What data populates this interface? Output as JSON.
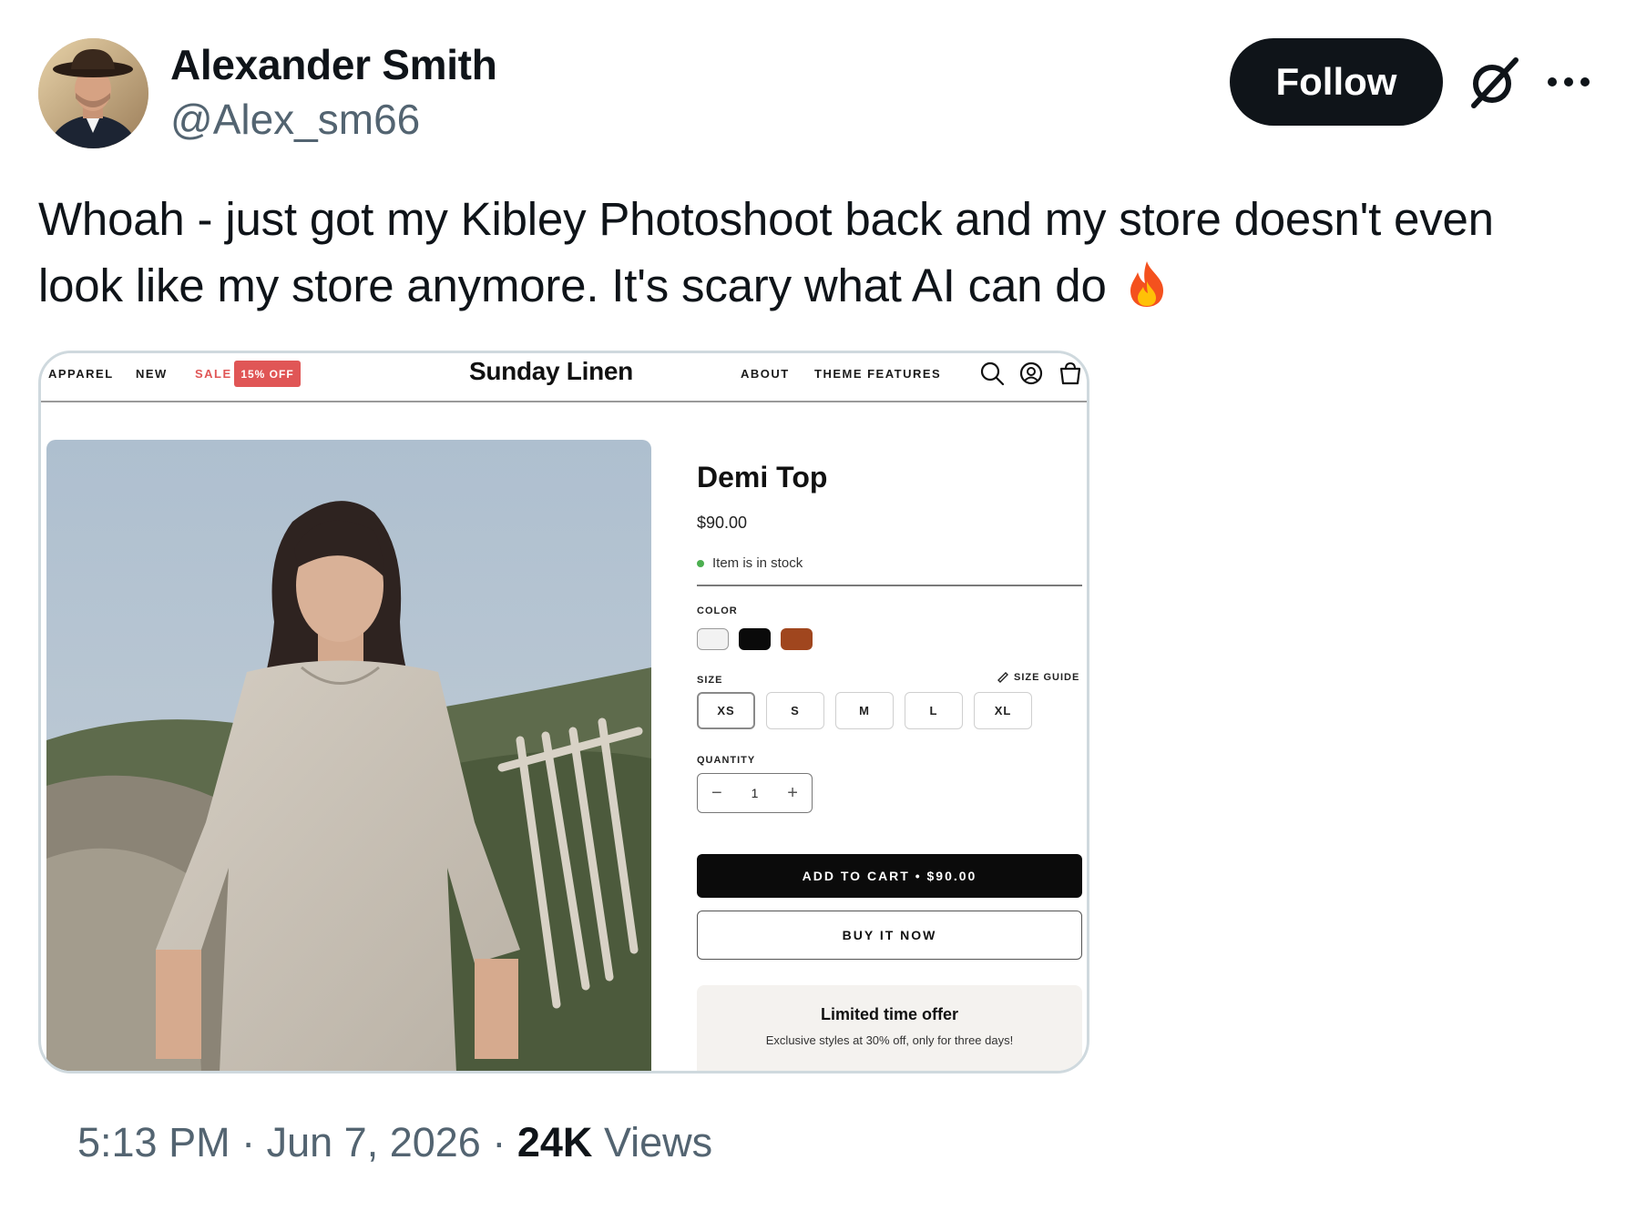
{
  "author": {
    "name": "Alexander Smith",
    "handle": "@Alex_sm66"
  },
  "actions": {
    "follow_label": "Follow",
    "grok_icon": "grok-icon",
    "more_icon": "more-icon"
  },
  "tweet": {
    "text": "Whoah - just got my Kibley Photoshoot back and my store doesn't even look like my store anymore. It's scary what AI can do",
    "emoji": "fire-icon"
  },
  "store": {
    "nav": {
      "apparel": "APPAREL",
      "new": "NEW",
      "sale": "SALE",
      "sale_badge": "15% OFF",
      "logo": "Sunday Linen",
      "about": "ABOUT",
      "theme_features": "THEME FEATURES",
      "icons": [
        "search-icon",
        "account-icon",
        "cart-icon"
      ]
    },
    "product": {
      "title": "Demi Top",
      "price": "$90.00",
      "stock": "Item is in stock",
      "color_label": "COLOR",
      "colors": [
        "#f2f2f2",
        "#0a0a0a",
        "#a0461e"
      ],
      "size_label": "SIZE",
      "size_guide": "SIZE GUIDE",
      "sizes": [
        "XS",
        "S",
        "M",
        "L",
        "XL"
      ],
      "selected_size": "XS",
      "quantity_label": "QUANTITY",
      "quantity": "1",
      "qty_minus": "−",
      "qty_plus": "+",
      "add_to_cart": "ADD TO CART • $90.00",
      "buy_now": "BUY IT NOW",
      "promo_title": "Limited time offer",
      "promo_text": "Exclusive styles at 30% off, only for three days!"
    }
  },
  "meta": {
    "time": "5:13 PM",
    "separator": "·",
    "date": "Jun 7, 2026",
    "views_count": "24K",
    "views_label": "Views"
  }
}
